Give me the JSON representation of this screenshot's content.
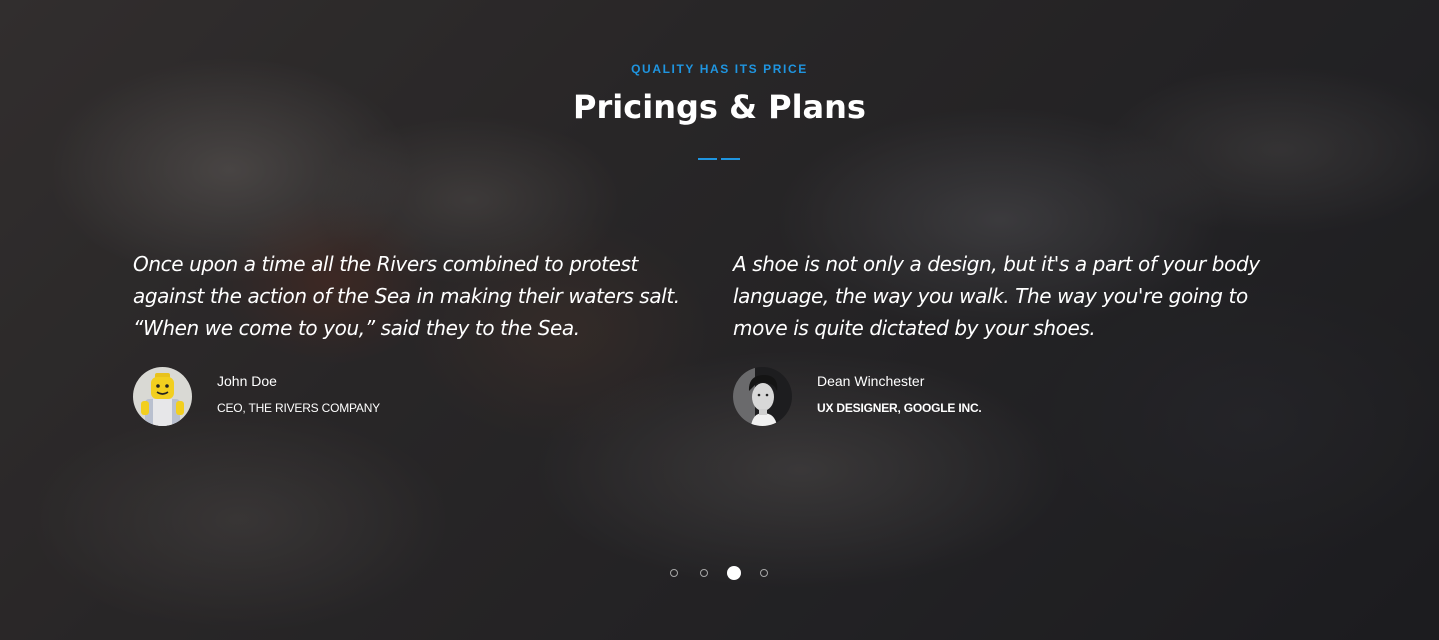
{
  "section": {
    "eyebrow": "QUALITY HAS ITS PRICE",
    "title": "Pricings & Plans",
    "accent_color": "#1f95e0"
  },
  "testimonials": [
    {
      "quote": "Once upon a time all the Rivers combined to protest against the action of the Sea in making their waters salt. “When we come to you,” said they to the Sea.",
      "author_name": "John Doe",
      "author_role": "CEO, THE RIVERS COMPANY",
      "avatar_icon": "lego-figure-avatar"
    },
    {
      "quote": "A shoe is not only a design, but it's a part of your body language, the way you walk. The way you're going to move is quite dictated by your shoes.",
      "author_name": "Dean Winchester",
      "author_role": "UX DESIGNER, GOOGLE INC.",
      "avatar_icon": "man-portrait-avatar"
    }
  ],
  "carousel": {
    "total_slides": 4,
    "active_slide": 3
  }
}
